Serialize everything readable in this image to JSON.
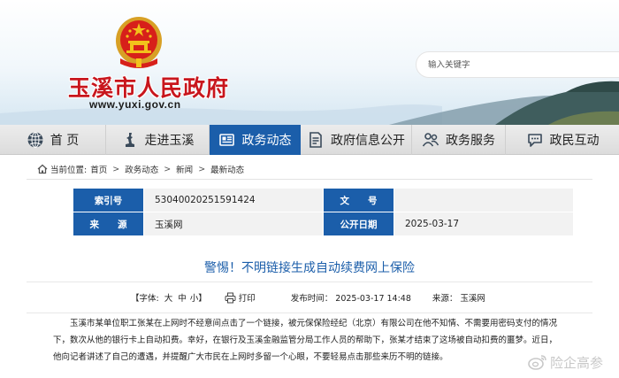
{
  "header": {
    "site_title": "玉溪市人民政府",
    "site_url": "www.yuxi.gov.cn",
    "search_placeholder": "输入关键字"
  },
  "nav": {
    "items": [
      {
        "label": "首 页",
        "icon": "globe-icon"
      },
      {
        "label": "走进玉溪",
        "icon": "statue-icon"
      },
      {
        "label": "政务动态",
        "icon": "newspaper-icon",
        "active": true
      },
      {
        "label": "政府信息公开",
        "icon": "document-icon"
      },
      {
        "label": "政务服务",
        "icon": "people-icon"
      },
      {
        "label": "政民互动",
        "icon": "chat-icon"
      }
    ]
  },
  "breadcrumb": {
    "label": "当前位置:",
    "items": [
      "首页",
      "政务动态",
      "新闻",
      "最新动态"
    ]
  },
  "meta": {
    "index_label": "索引号",
    "index_value": "53040020251591424",
    "doc_no_label": "文　　号",
    "doc_no_value": "",
    "source_label": "来　　源",
    "source_value": "玉溪网",
    "date_label": "公开日期",
    "date_value": "2025-03-17"
  },
  "article": {
    "title": "警惕！不明链接生成自动续费网上保险",
    "font_label": "【字体:",
    "font_large": "大",
    "font_medium": "中",
    "font_small": "小】",
    "print_label": "打印",
    "publish_time": "发布时间： 2025-03-17 14:48",
    "source": "来源： 玉溪网",
    "paragraph_lines": [
      "玉溪市某单位职工张某在上网时不经意间点击了一个链接，被元保保险经纪（北京）有限公司在他不知情、不需要用密码支付的情况",
      "下，数次从他的银行卡上自动扣费。幸好，在银行及玉溪金融监管分局工作人员的帮助下，张某才结束了这场被自动扣费的噩梦。近日，",
      "他向记者讲述了自己的遭遇，并提醒广大市民在上网时多留一个心眼，不要轻易点击那些来历不明的链接。"
    ]
  },
  "watermark": {
    "text": "险企高参"
  },
  "colors": {
    "brand_blue": "#1b5eaa",
    "title_red": "#c8161d",
    "nav_gray": "#e2e2e2"
  }
}
